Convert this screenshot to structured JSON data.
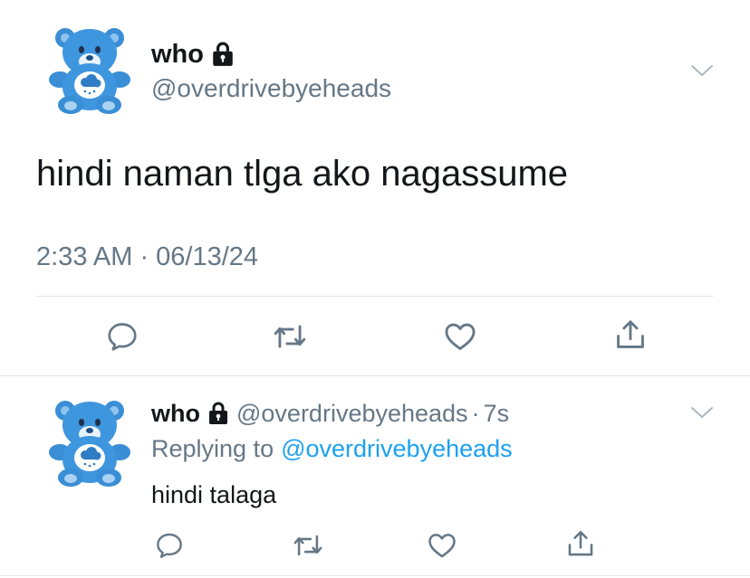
{
  "main_tweet": {
    "display_name": "who",
    "handle": "@overdrivebyeheads",
    "text": "hindi naman tlga ako nagassume",
    "timestamp": "2:33 AM · 06/13/24",
    "icons": {
      "avatar": "blue-care-bear-plush-avatar",
      "lock": "lock-icon",
      "menu": "chevron-down-icon",
      "reply": "speech-bubble-icon",
      "retweet": "retweet-icon",
      "like": "heart-icon",
      "share": "share-icon"
    }
  },
  "reply_tweet": {
    "display_name": "who",
    "handle": "@overdrivebyeheads",
    "separator": "·",
    "time_ago": "7s",
    "replying_prefix": "Replying to",
    "replying_handle": "@overdrivebyeheads",
    "text": "hindi talaga"
  },
  "colors": {
    "text_primary": "#14171a",
    "text_secondary": "#657786",
    "link": "#1da1f2",
    "divider": "#e1e8ed",
    "avatar_blue": "#3a8ed6"
  }
}
